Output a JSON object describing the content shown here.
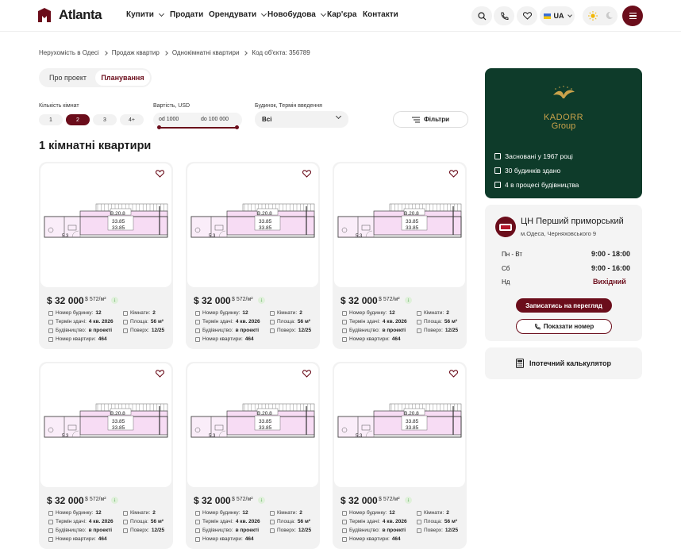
{
  "header": {
    "logo": "Atlanta",
    "nav": [
      {
        "label": "Купити",
        "dropdown": true
      },
      {
        "label": "Продати",
        "dropdown": false
      },
      {
        "label": "Орендувати",
        "dropdown": true
      },
      {
        "label": "Новобудова",
        "dropdown": true
      },
      {
        "label": "Кар'єра",
        "dropdown": false
      },
      {
        "label": "Контакти",
        "dropdown": false
      }
    ],
    "language": "UA",
    "accent_color": "#6b0d1b"
  },
  "breadcrumb": [
    "Нерухомість в Одесі",
    "Продаж квартир",
    "Однокімнатні квартири",
    "Код об'єкта: 356789"
  ],
  "tabs": [
    {
      "label": "Про проект"
    },
    {
      "label": "Планування"
    }
  ],
  "filters": {
    "rooms_label": "Кількість кімнат",
    "rooms": [
      "1",
      "2",
      "3",
      "4+"
    ],
    "rooms_selected": "2",
    "price_label": "Вартість, USD",
    "price_from": "od 1000",
    "price_to": "do 100 000",
    "building_label": "Будинок, Термін введення",
    "building_value": "Всі",
    "filters_button": "Фільтри"
  },
  "section_title": "1 кімнатні квартири",
  "plan_labels": {
    "unit": "В.20.8",
    "area1": "33.85",
    "area2": "33.85",
    "small": "5.3"
  },
  "listing": {
    "price": "$ 32 000",
    "price_per_m2": "$ 572/м²",
    "building_no_label": "Номер будинку:",
    "building_no": "12",
    "rooms_label": "Кімнати:",
    "rooms": "2",
    "deadline_label": "Термін здачі:",
    "deadline": "4 кв. 2026",
    "area_label": "Площа:",
    "area": "56 м²",
    "construction_label": "Будівництво:",
    "construction": "в проекті",
    "floor_label": "Поверх:",
    "floor": "12/25",
    "apartment_no_label": "Номер квартири:",
    "apartment_no": "464"
  },
  "developer": {
    "name_line1": "KADORR",
    "name_line2": "Group",
    "facts": [
      "Засновані у 1967 році",
      "30 будинків здано",
      "4 в процесі будівництва"
    ],
    "bg_color": "#0e3b2a"
  },
  "office": {
    "name": "ЦН Перший приморський",
    "address": "м.Одеса, Черняховського 9",
    "hours": [
      {
        "days": "Пн - Вт",
        "time": "9:00 - 18:00"
      },
      {
        "days": "Сб",
        "time": "9:00 - 16:00"
      },
      {
        "days": "Нд",
        "time": "Вихідний"
      }
    ],
    "book_button": "Записатись на перегляд",
    "phone_button": "Показати номер"
  },
  "calculator": "Іпотечний калькулятор"
}
